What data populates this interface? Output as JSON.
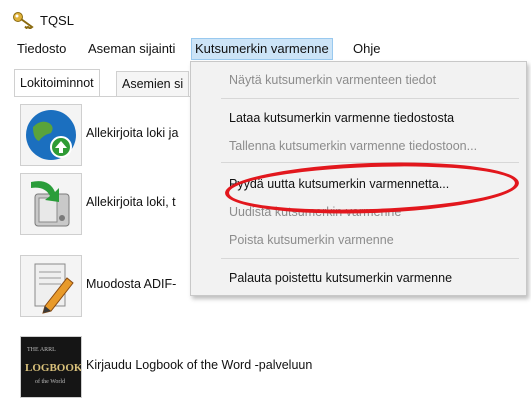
{
  "window": {
    "title": "TQSL"
  },
  "menubar": {
    "items": [
      "Tiedosto",
      "Aseman sijainti",
      "Kutsumerkin varmenne",
      "Ohje"
    ]
  },
  "tabs": [
    "Lokitoiminnot",
    "Asemien si"
  ],
  "actions": [
    {
      "label": "Allekirjoita loki ja",
      "icon": "globe-upload-icon"
    },
    {
      "label": "Allekirjoita loki, t",
      "icon": "save-drive-icon"
    },
    {
      "label": "Muodosta ADIF-",
      "icon": "edit-document-icon"
    },
    {
      "label": "Kirjaudu Logbook of the Word -palveluun",
      "icon": "lotw-logo-icon"
    }
  ],
  "dropdown": {
    "items": [
      {
        "label": "Näytä kutsumerkin varmenteen tiedot",
        "enabled": false
      },
      {
        "label": "Lataa kutsumerkin varmenne tiedostosta",
        "enabled": true
      },
      {
        "label": "Tallenna kutsumerkin varmenne tiedostoon...",
        "enabled": false
      },
      {
        "label": "Pyydä uutta kutsumerkin varmennetta...",
        "enabled": true
      },
      {
        "label": "Uudista kutsumerkin varmenne",
        "enabled": false
      },
      {
        "label": "Poista kutsumerkin varmenne",
        "enabled": false
      },
      {
        "label": "Palauta poistettu kutsumerkin varmenne",
        "enabled": true
      }
    ]
  },
  "logo_text": {
    "top": "THE ARRL",
    "main": "LOGBOOK",
    "sub": "of the World"
  },
  "colors": {
    "menu_active_bg": "#cce4f7",
    "highlight_oval": "#e2171d",
    "disabled_text": "#8c8c8c"
  }
}
